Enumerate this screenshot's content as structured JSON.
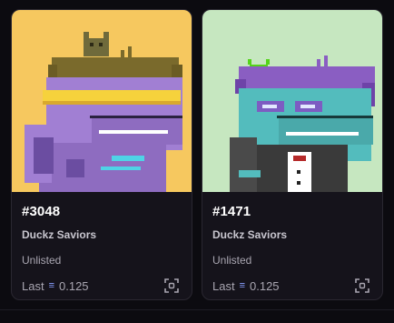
{
  "cards": [
    {
      "token_id": "#3048",
      "collection": "Duckz Saviors",
      "listing_status": "Unlisted",
      "last_label": "Last",
      "last_price": "0.125",
      "currency_icon": "eth-icon",
      "expand_icon": "expand-icon",
      "art_background": "#f6c85f"
    },
    {
      "token_id": "#1471",
      "collection": "Duckz Saviors",
      "listing_status": "Unlisted",
      "last_label": "Last",
      "last_price": "0.125",
      "currency_icon": "eth-icon",
      "expand_icon": "expand-icon",
      "art_background": "#c6e7c0"
    }
  ]
}
